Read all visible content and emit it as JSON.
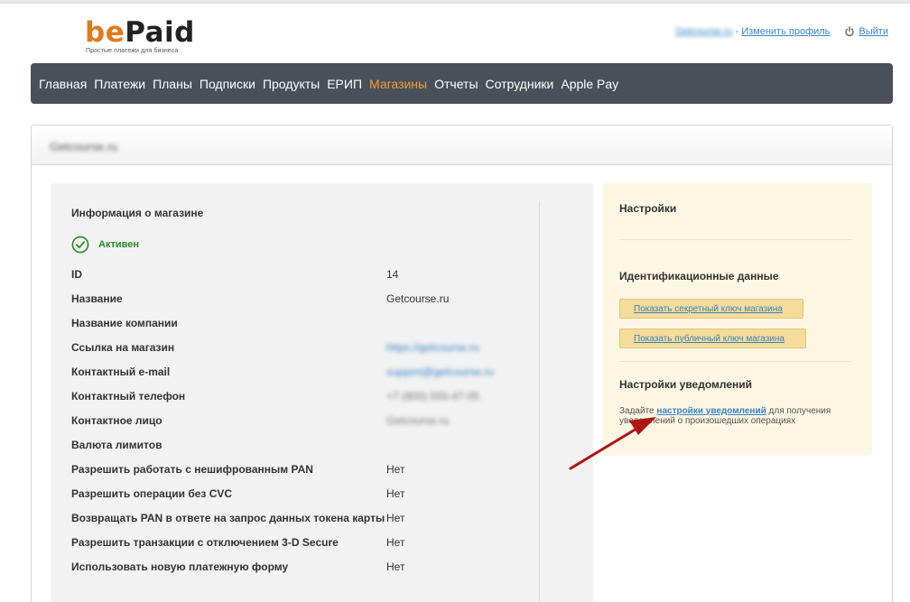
{
  "header": {
    "logo_be": "be",
    "logo_paid": "Paid",
    "tagline": "Простые платежи для бизнеса",
    "user_email": "Getcourse.ru",
    "separator": "-",
    "profile_link": "Изменить профиль",
    "logout_label": "Выйти"
  },
  "nav": {
    "items": [
      {
        "label": "Главная"
      },
      {
        "label": "Платежи"
      },
      {
        "label": "Планы"
      },
      {
        "label": "Подписки"
      },
      {
        "label": "Продукты"
      },
      {
        "label": "ЕРИП"
      },
      {
        "label": "Магазины"
      },
      {
        "label": "Отчеты"
      },
      {
        "label": "Сотрудники"
      },
      {
        "label": "Apple Pay"
      }
    ],
    "active_index": 6
  },
  "panel": {
    "title": "Getcourse.ru"
  },
  "info": {
    "title": "Информация о магазине",
    "status": "Активен",
    "rows": [
      {
        "label": "ID",
        "value": "14"
      },
      {
        "label": "Название",
        "value": "Getcourse.ru"
      },
      {
        "label": "Название компании",
        "value": ""
      },
      {
        "label": "Ссылка на магазин",
        "value": "https://getcourse.ru"
      },
      {
        "label": "Контактный e-mail",
        "value": "support@getcourse.ru"
      },
      {
        "label": "Контактный телефон",
        "value": "+7 (800) 555-47-05"
      },
      {
        "label": "Контактное лицо",
        "value": "Getcourse.ru"
      },
      {
        "label": "Валюта лимитов",
        "value": ""
      },
      {
        "label": "Разрешить работать с нешифрованным PAN",
        "value": "Нет"
      },
      {
        "label": "Разрешить операции без CVC",
        "value": "Нет"
      },
      {
        "label": "Возвращать PAN в ответе на запрос данных токена карты",
        "value": "Нет"
      },
      {
        "label": "Разрешить транзакции с отключением 3-D Secure",
        "value": "Нет"
      },
      {
        "label": "Использовать новую платежную форму",
        "value": "Нет"
      }
    ]
  },
  "settings": {
    "title": "Настройки",
    "ident_title": "Идентификационные данные",
    "secret_key_button": "Показать секретный ключ магазина",
    "public_key_button": "Показать публичный ключ магазина",
    "notify_title": "Настройки уведомлений",
    "notify_prefix": "Задайте",
    "notify_link": "настройки уведомлений",
    "notify_suffix": "для получения уведомлений о произошедших операциях"
  },
  "colors": {
    "brand_orange": "#e07b1d",
    "nav_bg": "#4a5059",
    "nav_active": "#f29c38",
    "link": "#3a82c4",
    "status_green": "#2a8a2a",
    "settings_bg": "#fdf6e2",
    "arrow_red": "#b01515"
  },
  "icons": {
    "logout": "power-icon",
    "status": "check-circle-icon",
    "annotation": "red-arrow-annotation"
  }
}
